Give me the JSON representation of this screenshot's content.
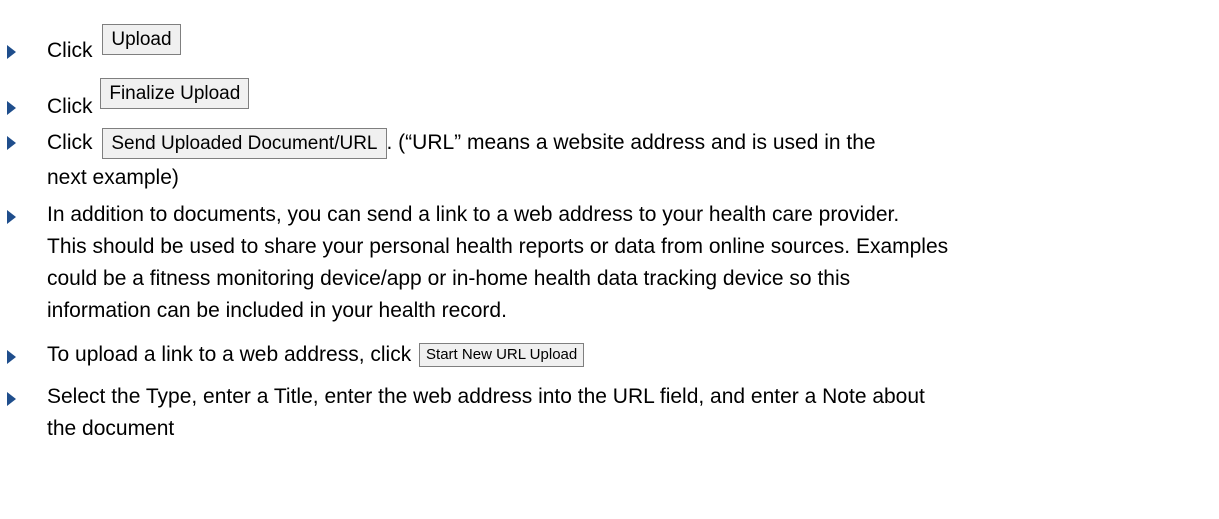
{
  "steps": [
    {
      "prefix": "Click",
      "button": "Upload"
    },
    {
      "prefix": "Click",
      "button": "Finalize Upload"
    },
    {
      "prefix": "Click",
      "button": "Send Uploaded Document/URL",
      "suffix": ". (“URL” means a website address and is used in the",
      "line2": "next example)"
    },
    {
      "lines": [
        "In addition to documents, you can send a link to a web address to your health care provider.",
        "This should be used to share your personal health reports or data from online sources. Examples",
        "could be a fitness monitoring device/app or in-home health data tracking device so this",
        "information can be included in your health record."
      ]
    },
    {
      "prefix": "To upload a link to a web address, click",
      "button": "Start New URL Upload"
    },
    {
      "lines": [
        "Select the Type, enter a Title, enter the web address into the URL field, and enter a Note about",
        "the document"
      ]
    }
  ],
  "colors": {
    "bullet": "#1f4e8c",
    "button_bg": "#f0f0f0",
    "button_border": "#7f7f7f"
  }
}
